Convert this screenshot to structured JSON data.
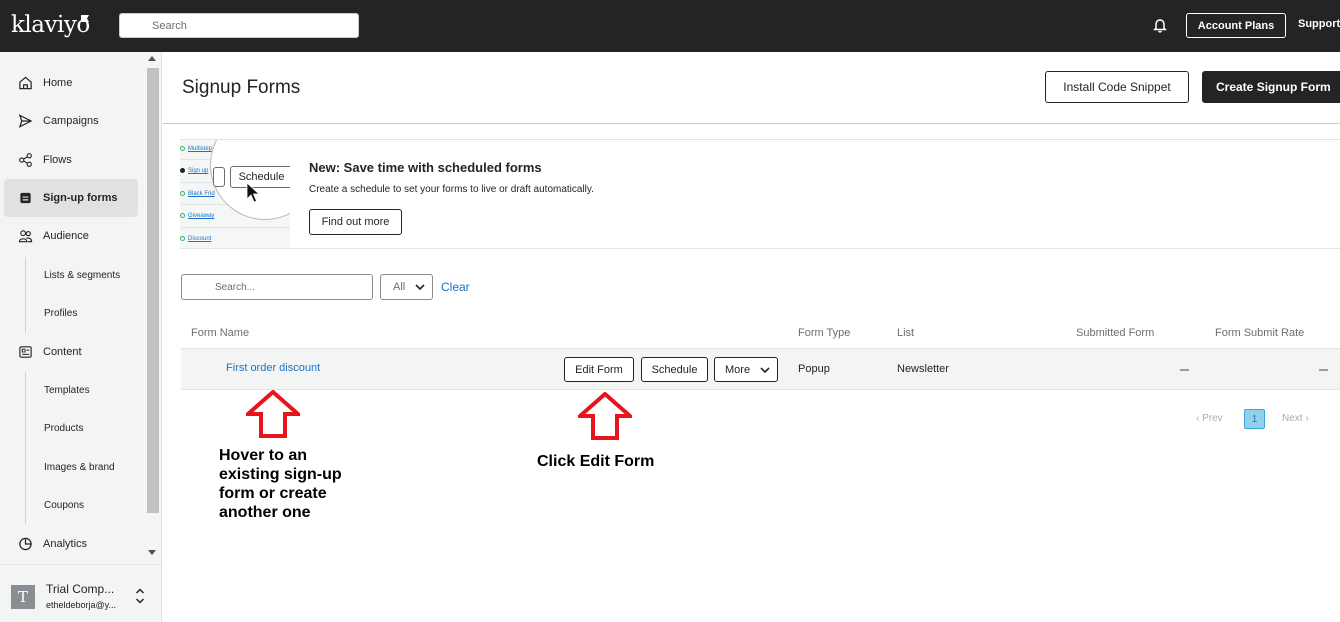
{
  "topbar": {
    "logo": "klaviyo",
    "search_placeholder": "Search",
    "account_plans_label": "Account Plans",
    "support_label": "Support"
  },
  "sidebar": {
    "items": [
      {
        "label": "Home",
        "icon": "home-icon"
      },
      {
        "label": "Campaigns",
        "icon": "send-icon"
      },
      {
        "label": "Flows",
        "icon": "flows-icon"
      },
      {
        "label": "Sign-up forms",
        "icon": "form-icon"
      },
      {
        "label": "Audience",
        "icon": "people-icon"
      },
      {
        "label": "Content",
        "icon": "content-icon"
      },
      {
        "label": "Analytics",
        "icon": "pie-chart-icon"
      }
    ],
    "audience_sub": [
      "Lists & segments",
      "Profiles"
    ],
    "content_sub": [
      "Templates",
      "Products",
      "Images & brand",
      "Coupons"
    ],
    "company": {
      "initial": "T",
      "name": "Trial Comp...",
      "email": "etheldeborja@y..."
    }
  },
  "header": {
    "title": "Signup Forms",
    "install_label": "Install Code Snippet",
    "create_label": "Create Signup Form"
  },
  "banner": {
    "title": "New: Save time with scheduled forms",
    "description": "Create a schedule to set your forms to live or draft automatically.",
    "button_label": "Find out more",
    "image_items": [
      "Multistep",
      "Sign up",
      "Black Frid",
      "Giveaway",
      "Discount"
    ],
    "image_button": "Schedule"
  },
  "filters": {
    "search_placeholder": "Search...",
    "select_value": "All",
    "clear_label": "Clear"
  },
  "table": {
    "headers": [
      "Form Name",
      "Form Type",
      "List",
      "Submitted Form",
      "Form Submit Rate"
    ],
    "rows": [
      {
        "name": "First order discount",
        "type": "Popup",
        "list": "Newsletter"
      }
    ],
    "actions": {
      "edit": "Edit Form",
      "schedule": "Schedule",
      "more": "More"
    }
  },
  "pagination": {
    "prev": "Prev",
    "page": "1",
    "next": "Next"
  },
  "annotations": {
    "hover": "Hover to an existing sign-up form or create another one",
    "click": "Click Edit Form",
    "arrow_color": "#e8141b"
  }
}
